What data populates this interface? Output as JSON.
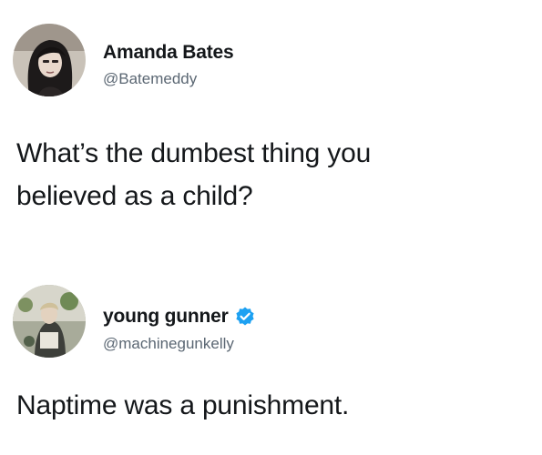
{
  "tweets": [
    {
      "author": {
        "display_name": "Amanda Bates",
        "handle": "@Batemeddy",
        "verified": false,
        "avatar_icon": "profile-photo-woman-dark-hair"
      },
      "text_lines": [
        "What’s the dumbest thing you",
        "believed as a child?"
      ]
    },
    {
      "author": {
        "display_name": "young gunner",
        "handle": "@machinegunkelly",
        "verified": true,
        "verified_icon": "verified-badge-icon",
        "avatar_icon": "profile-photo-man-outdoors"
      },
      "text": "Naptime was a punishment."
    }
  ],
  "colors": {
    "text_primary": "#14171a",
    "text_secondary": "#5b6773",
    "verified_blue": "#1da1f2",
    "background": "#ffffff"
  }
}
